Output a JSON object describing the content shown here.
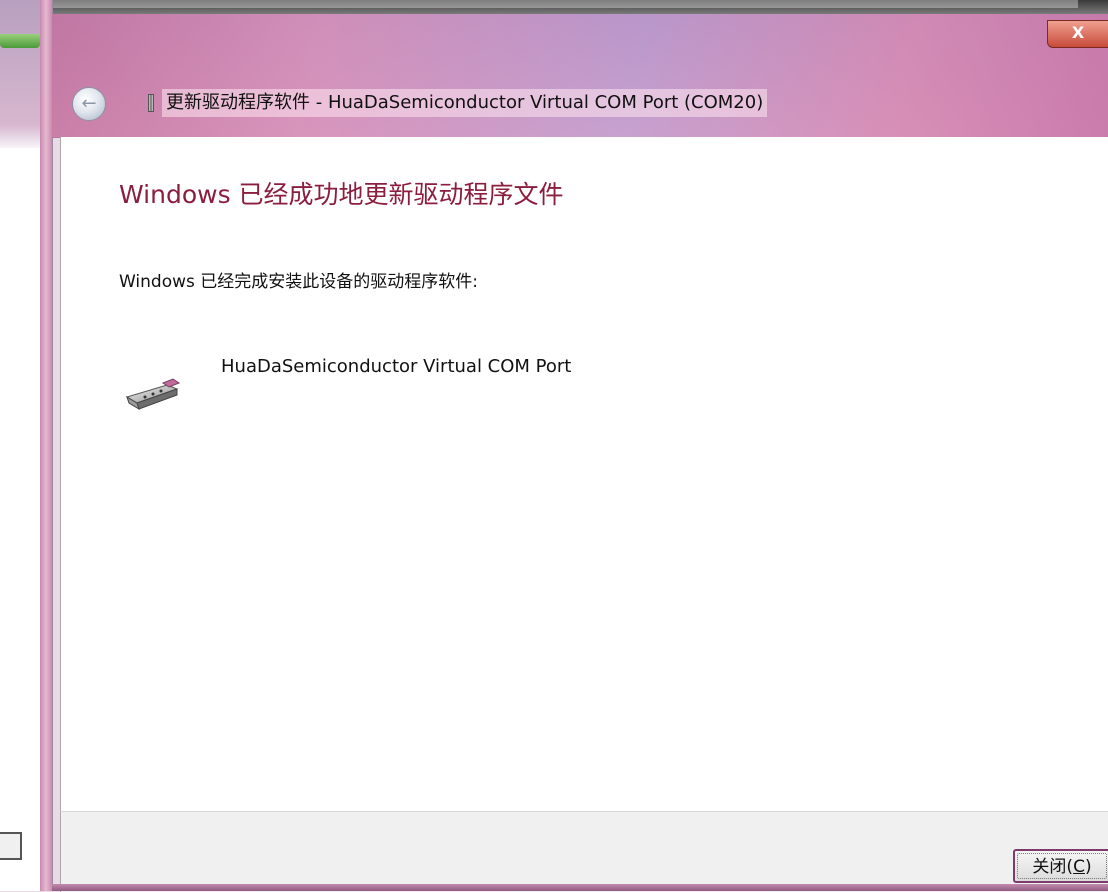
{
  "dialog": {
    "title": "更新驱动程序软件 - HuaDaSemiconductor Virtual COM Port (COM20)",
    "heading": "Windows 已经成功地更新驱动程序文件",
    "intro": "Windows 已经完成安装此设备的驱动程序软件:",
    "device_name": "HuaDaSemiconductor Virtual COM Port",
    "close_button": "关闭(C)",
    "close_button_accesskey": "C",
    "window_close_glyph": "X",
    "back_glyph": "←"
  },
  "icons": {
    "back": "back-arrow-icon",
    "device": "serial-port-connector-icon",
    "title_device": "device-icon",
    "window_close": "close-icon"
  },
  "colors": {
    "heading": "#8b1e3f",
    "titlebar_accent": "#d692ba",
    "close_button_border": "#7d3b6c",
    "footer_bg": "#f0f0f0"
  }
}
